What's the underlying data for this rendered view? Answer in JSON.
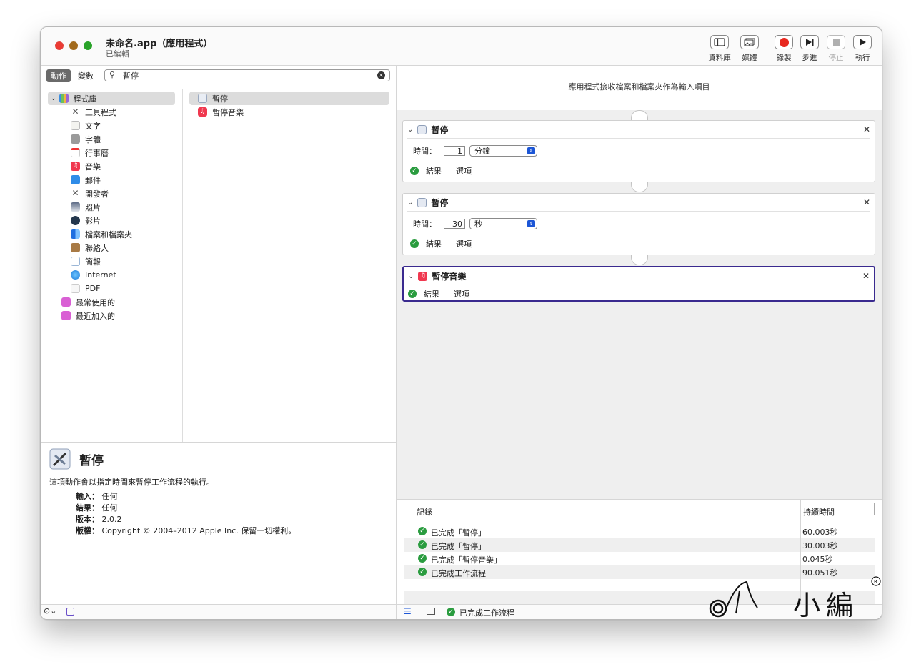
{
  "window": {
    "title": "未命名.app（應用程式）",
    "subtitle": "已編輯"
  },
  "toolbar": [
    {
      "label": "資料庫",
      "icon": "sidebar-icon",
      "enabled": true
    },
    {
      "label": "媒體",
      "icon": "photos-icon",
      "enabled": true
    },
    {
      "label": "錄製",
      "icon": "record-icon",
      "enabled": true
    },
    {
      "label": "步進",
      "icon": "step-icon",
      "enabled": true
    },
    {
      "label": "停止",
      "icon": "stop-icon",
      "enabled": false
    },
    {
      "label": "執行",
      "icon": "play-icon",
      "enabled": true
    }
  ],
  "left": {
    "segments": [
      "動作",
      "變數"
    ],
    "search": {
      "value": "暫停"
    },
    "library": [
      {
        "label": "程式庫",
        "icon": "library-icon",
        "selected": true
      },
      {
        "label": "工具程式",
        "icon": "utilities-icon"
      },
      {
        "label": "文字",
        "icon": "text-icon"
      },
      {
        "label": "字體",
        "icon": "fonts-icon"
      },
      {
        "label": "行事曆",
        "icon": "calendar-icon"
      },
      {
        "label": "音樂",
        "icon": "music-icon"
      },
      {
        "label": "郵件",
        "icon": "mail-icon"
      },
      {
        "label": "開發者",
        "icon": "developer-icon"
      },
      {
        "label": "照片",
        "icon": "photos-icon"
      },
      {
        "label": "影片",
        "icon": "movies-icon"
      },
      {
        "label": "檔案和檔案夾",
        "icon": "finder-icon"
      },
      {
        "label": "聯絡人",
        "icon": "contacts-icon"
      },
      {
        "label": "簡報",
        "icon": "presentation-icon"
      },
      {
        "label": "Internet",
        "icon": "internet-icon"
      },
      {
        "label": "PDF",
        "icon": "pdf-icon"
      },
      {
        "label": "最常使用的",
        "icon": "smart-folder-icon"
      },
      {
        "label": "最近加入的",
        "icon": "smart-folder-icon"
      }
    ],
    "results": [
      {
        "label": "暫停",
        "icon": "pause-action-icon",
        "selected": true
      },
      {
        "label": "暫停音樂",
        "icon": "music-icon"
      }
    ],
    "description": {
      "title": "暫停",
      "text": "這項動作會以指定時間來暫停工作流程的執行。",
      "input_label": "輸入：",
      "input": "任何",
      "result_label": "結果：",
      "result": "任何",
      "version_label": "版本：",
      "version": "2.0.2",
      "copyright_label": "版權：",
      "copyright": "Copyright © 2004–2012 Apple Inc. 保留一切權利。"
    }
  },
  "workflow": {
    "hint": "應用程式接收檔案和檔案夾作為輸入項目",
    "actions": [
      {
        "name": "暫停",
        "time_label": "時間：",
        "value": "1",
        "unit": "分鐘",
        "results": "結果",
        "options": "選項"
      },
      {
        "name": "暫停",
        "time_label": "時間：",
        "value": "30",
        "unit": "秒",
        "results": "結果",
        "options": "選項"
      },
      {
        "name": "暫停音樂",
        "results": "結果",
        "options": "選項"
      }
    ]
  },
  "log": {
    "col_log": "記錄",
    "col_duration": "持續時間",
    "rows": [
      {
        "text": "已完成「暫停」",
        "duration": "60.003秒"
      },
      {
        "text": "已完成「暫停」",
        "duration": "30.003秒"
      },
      {
        "text": "已完成「暫停音樂」",
        "duration": "0.045秒"
      },
      {
        "text": "已完成工作流程",
        "duration": "90.051秒"
      }
    ]
  },
  "status": {
    "text": "已完成工作流程"
  },
  "watermark": {
    "text": "小編"
  },
  "colors": {
    "accent": "#1c56d6",
    "success": "#2a9c3f",
    "active_border": "#3a2a8f",
    "record": "#e8281f"
  }
}
